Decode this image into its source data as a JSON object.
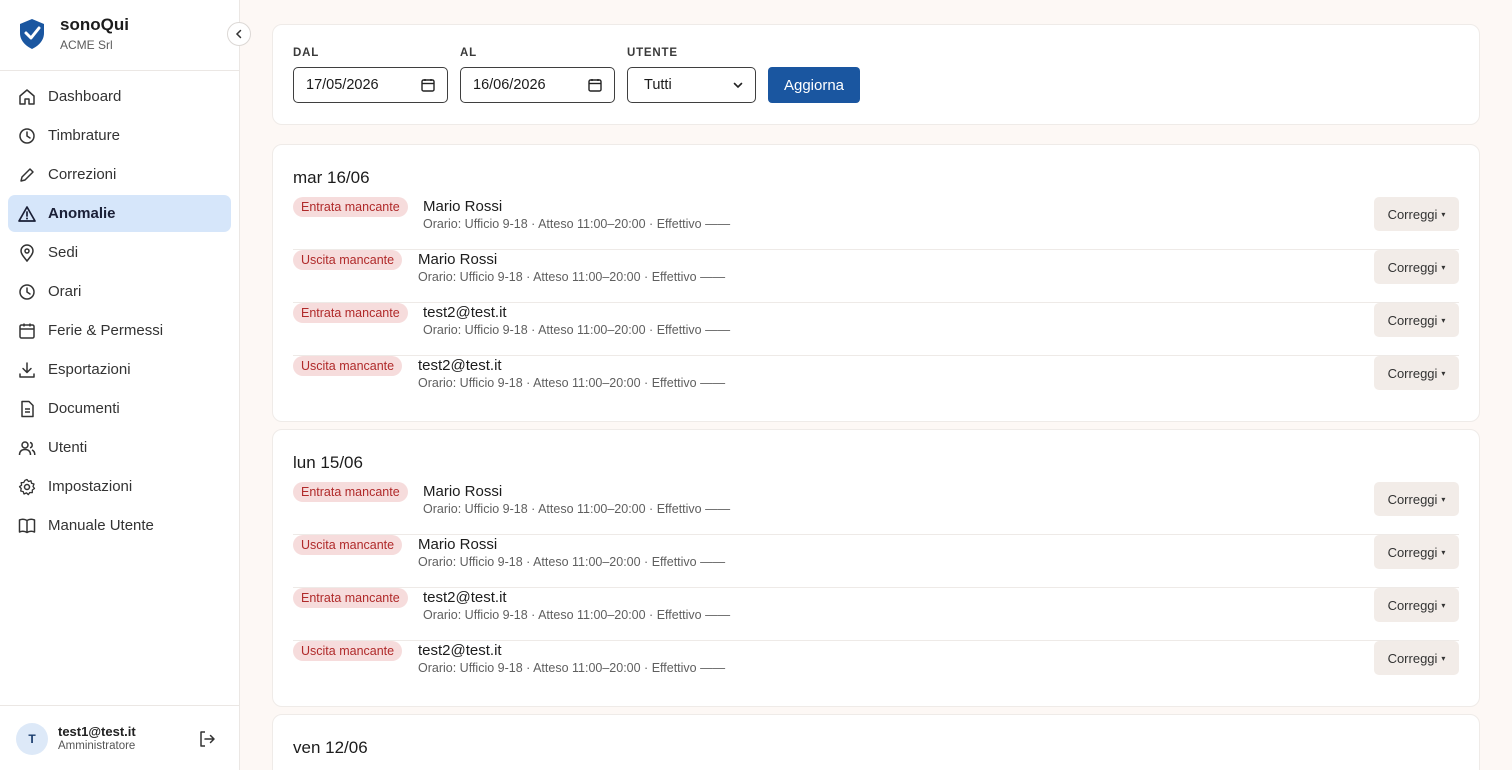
{
  "brand": {
    "name": "sonoQui",
    "org": "ACME Srl"
  },
  "nav": [
    {
      "label": "Dashboard",
      "icon": "home-icon"
    },
    {
      "label": "Timbrature",
      "icon": "clock-icon"
    },
    {
      "label": "Correzioni",
      "icon": "pencil-icon"
    },
    {
      "label": "Anomalie",
      "icon": "warning-icon",
      "active": true
    },
    {
      "label": "Sedi",
      "icon": "map-pin-icon"
    },
    {
      "label": "Orari",
      "icon": "clock-icon"
    },
    {
      "label": "Ferie & Permessi",
      "icon": "calendar-icon"
    },
    {
      "label": "Esportazioni",
      "icon": "download-icon"
    },
    {
      "label": "Documenti",
      "icon": "document-icon"
    },
    {
      "label": "Utenti",
      "icon": "users-icon"
    },
    {
      "label": "Impostazioni",
      "icon": "gear-icon"
    },
    {
      "label": "Manuale Utente",
      "icon": "book-icon"
    }
  ],
  "user": {
    "initial": "T",
    "email": "test1@test.it",
    "role": "Amministratore"
  },
  "filters": {
    "from_label": "DAL",
    "from_value": "17/05/2026",
    "to_label": "AL",
    "to_value": "16/06/2026",
    "user_label": "UTENTE",
    "user_value": "Tutti",
    "refresh_label": "Aggiorna"
  },
  "fix_label": "Correggi",
  "days": [
    {
      "title": "mar 16/06",
      "rows": [
        {
          "badge": "Entrata mancante",
          "name": "Mario Rossi",
          "detail": "Orario: Ufficio 9-18 · Atteso 11:00–20:00 · Effettivo ——"
        },
        {
          "badge": "Uscita mancante",
          "name": "Mario Rossi",
          "detail": "Orario: Ufficio 9-18 · Atteso 11:00–20:00 · Effettivo ——"
        },
        {
          "badge": "Entrata mancante",
          "name": "test2@test.it",
          "detail": "Orario: Ufficio 9-18 · Atteso 11:00–20:00 · Effettivo ——"
        },
        {
          "badge": "Uscita mancante",
          "name": "test2@test.it",
          "detail": "Orario: Ufficio 9-18 · Atteso 11:00–20:00 · Effettivo ——"
        }
      ]
    },
    {
      "title": "lun 15/06",
      "rows": [
        {
          "badge": "Entrata mancante",
          "name": "Mario Rossi",
          "detail": "Orario: Ufficio 9-18 · Atteso 11:00–20:00 · Effettivo ——"
        },
        {
          "badge": "Uscita mancante",
          "name": "Mario Rossi",
          "detail": "Orario: Ufficio 9-18 · Atteso 11:00–20:00 · Effettivo ——"
        },
        {
          "badge": "Entrata mancante",
          "name": "test2@test.it",
          "detail": "Orario: Ufficio 9-18 · Atteso 11:00–20:00 · Effettivo ——"
        },
        {
          "badge": "Uscita mancante",
          "name": "test2@test.it",
          "detail": "Orario: Ufficio 9-18 · Atteso 11:00–20:00 · Effettivo ——"
        }
      ]
    },
    {
      "title": "ven 12/06",
      "rows": []
    }
  ]
}
